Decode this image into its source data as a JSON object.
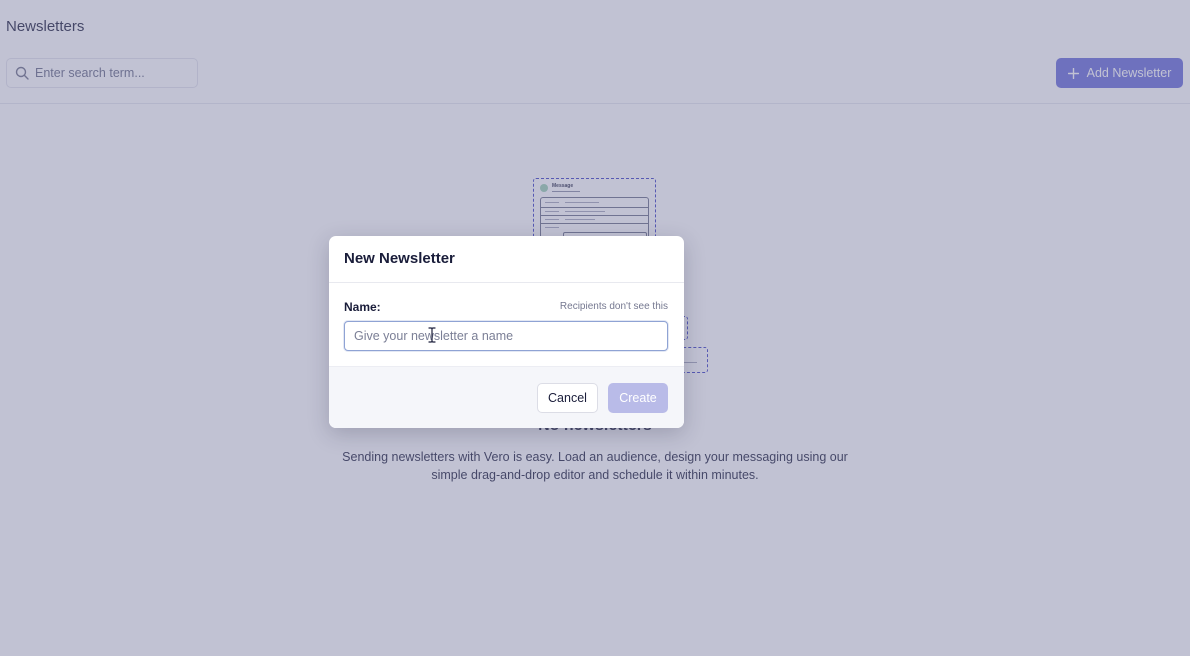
{
  "page": {
    "title": "Newsletters",
    "search_placeholder": "Enter search term...",
    "search_icon": "search-icon",
    "add_button_label": "Add Newsletter",
    "add_button_icon": "plus-icon",
    "accent_color": "#6769d8"
  },
  "illustration": {
    "heading": "Message"
  },
  "empty_state": {
    "title": "No newsletters",
    "description": "Sending newsletters with Vero is easy. Load an audience, design your messaging using our simple drag-and-drop editor and schedule it within minutes."
  },
  "modal": {
    "title": "New Newsletter",
    "name_label": "Name:",
    "name_hint": "Recipients don't see this",
    "name_value": "",
    "name_placeholder": "Give your newsletter a name",
    "cancel_label": "Cancel",
    "create_label": "Create",
    "create_color": "#b9bbe8"
  }
}
